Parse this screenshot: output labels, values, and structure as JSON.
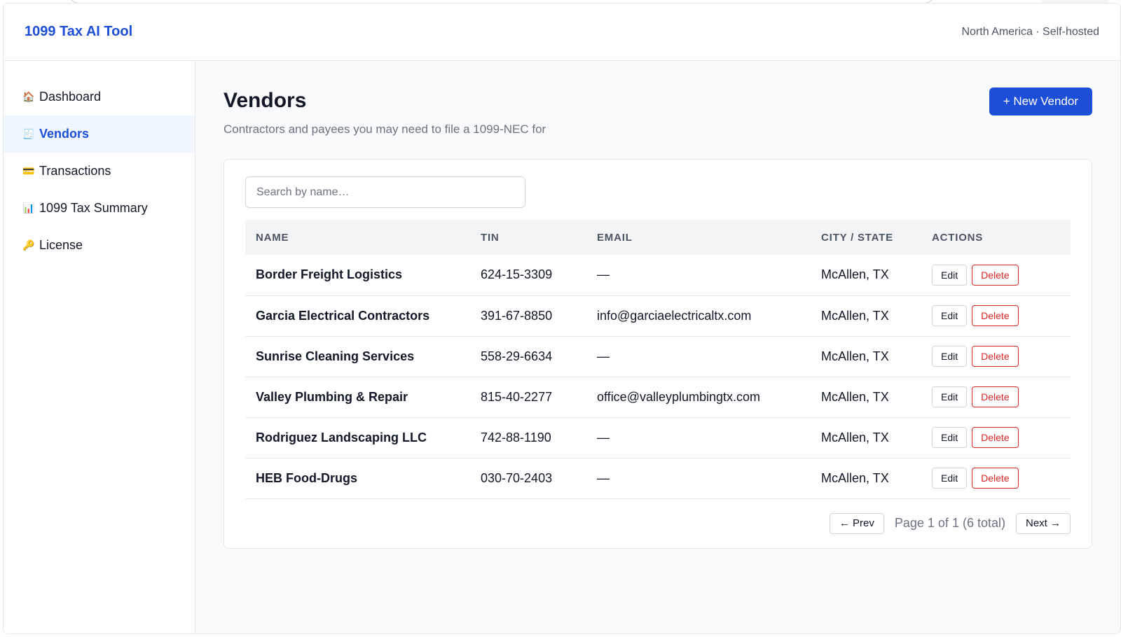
{
  "app": {
    "brand": "1099 Tax AI Tool",
    "region": "North America · Self-hosted"
  },
  "sidebar": {
    "items": [
      {
        "icon": "🏠",
        "icon_name": "house-icon",
        "label": "Dashboard",
        "active": false
      },
      {
        "icon": "🧾",
        "icon_name": "receipt-icon",
        "label": "Vendors",
        "active": true
      },
      {
        "icon": "💳",
        "icon_name": "credit-card-icon",
        "label": "Transactions",
        "active": false
      },
      {
        "icon": "📊",
        "icon_name": "bar-chart-icon",
        "label": "1099 Tax Summary",
        "active": false
      },
      {
        "icon": "🔑",
        "icon_name": "key-icon",
        "label": "License",
        "active": false
      }
    ]
  },
  "page": {
    "title": "Vendors",
    "subtitle": "Contractors and payees you may need to file a 1099-NEC for",
    "new_button": "+ New Vendor"
  },
  "search": {
    "placeholder": "Search by name…",
    "value": ""
  },
  "table": {
    "columns": [
      "NAME",
      "TIN",
      "EMAIL",
      "CITY / STATE",
      "ACTIONS"
    ],
    "edit_label": "Edit",
    "delete_label": "Delete",
    "rows": [
      {
        "name": "Border Freight Logistics",
        "tin": "624-15-3309",
        "email": "—",
        "city_state": "McAllen, TX"
      },
      {
        "name": "Garcia Electrical Contractors",
        "tin": "391-67-8850",
        "email": "info@garciaelectricaltx.com",
        "city_state": "McAllen, TX"
      },
      {
        "name": "Sunrise Cleaning Services",
        "tin": "558-29-6634",
        "email": "—",
        "city_state": "McAllen, TX"
      },
      {
        "name": "Valley Plumbing & Repair",
        "tin": "815-40-2277",
        "email": "office@valleyplumbingtx.com",
        "city_state": "McAllen, TX"
      },
      {
        "name": "Rodriguez Landscaping LLC",
        "tin": "742-88-1190",
        "email": "—",
        "city_state": "McAllen, TX"
      },
      {
        "name": "HEB Food-Drugs",
        "tin": "030-70-2403",
        "email": "—",
        "city_state": "McAllen, TX"
      }
    ]
  },
  "pagination": {
    "prev_label": "← Prev",
    "info": "Page 1 of 1 (6 total)",
    "next_label": "Next →"
  },
  "colors": {
    "accent": "#1d4ed8",
    "danger": "#dc2626",
    "active_nav_bg": "#eff6ff"
  }
}
